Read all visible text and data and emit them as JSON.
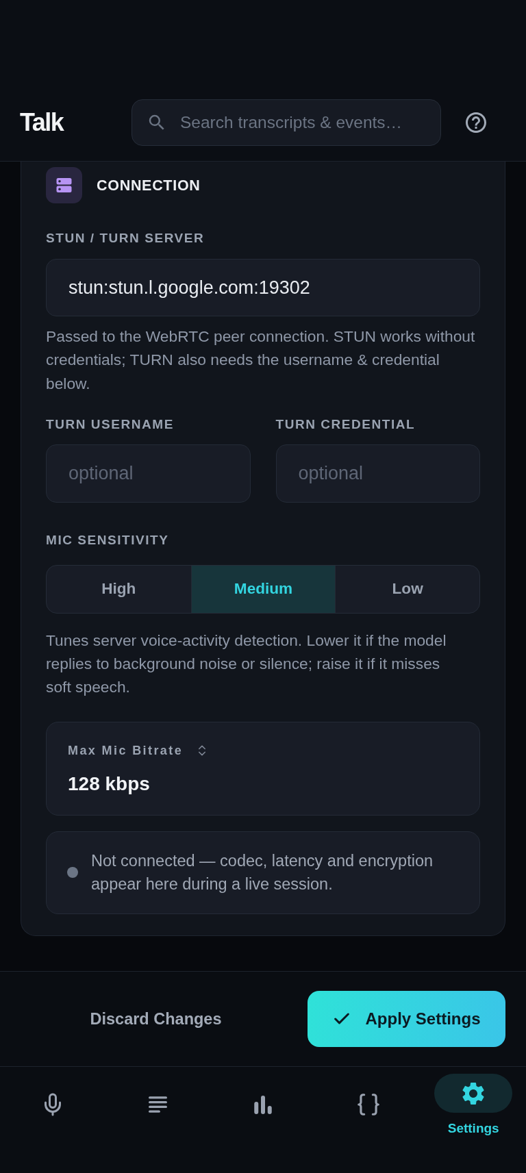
{
  "header": {
    "title": "Talk",
    "search": {
      "placeholder": "Search transcripts & events…"
    }
  },
  "section": {
    "title": "CONNECTION",
    "server": {
      "label": "STUN / TURN SERVER",
      "value": "stun:stun.l.google.com:19302",
      "help": "Passed to the WebRTC peer connection. STUN works without credentials; TURN also needs the username & credential below."
    },
    "credentials": [
      {
        "label": "TURN USERNAME",
        "placeholder": "optional"
      },
      {
        "label": "TURN CREDENTIAL",
        "placeholder": "optional"
      }
    ],
    "mic_sensitivity": {
      "label": "MIC SENSITIVITY",
      "options": [
        {
          "label": "High",
          "selected": false
        },
        {
          "label": "Medium",
          "selected": true
        },
        {
          "label": "Low",
          "selected": false
        }
      ],
      "help": "Tunes server voice-activity detection. Lower it if the model replies to background noise or silence; raise it if it misses soft speech."
    },
    "bitrate": {
      "label": "Max Mic Bitrate",
      "value": "128 kbps"
    },
    "status": {
      "connected": false,
      "text": "Not connected — codec, latency and encryption appear here during a live session."
    }
  },
  "actions": {
    "discard": "Discard Changes",
    "apply": "Apply Settings"
  },
  "nav": [
    {
      "selected": false
    },
    {
      "selected": false
    },
    {
      "selected": false
    },
    {
      "selected": false
    },
    {
      "label": "Settings",
      "selected": true
    }
  ]
}
